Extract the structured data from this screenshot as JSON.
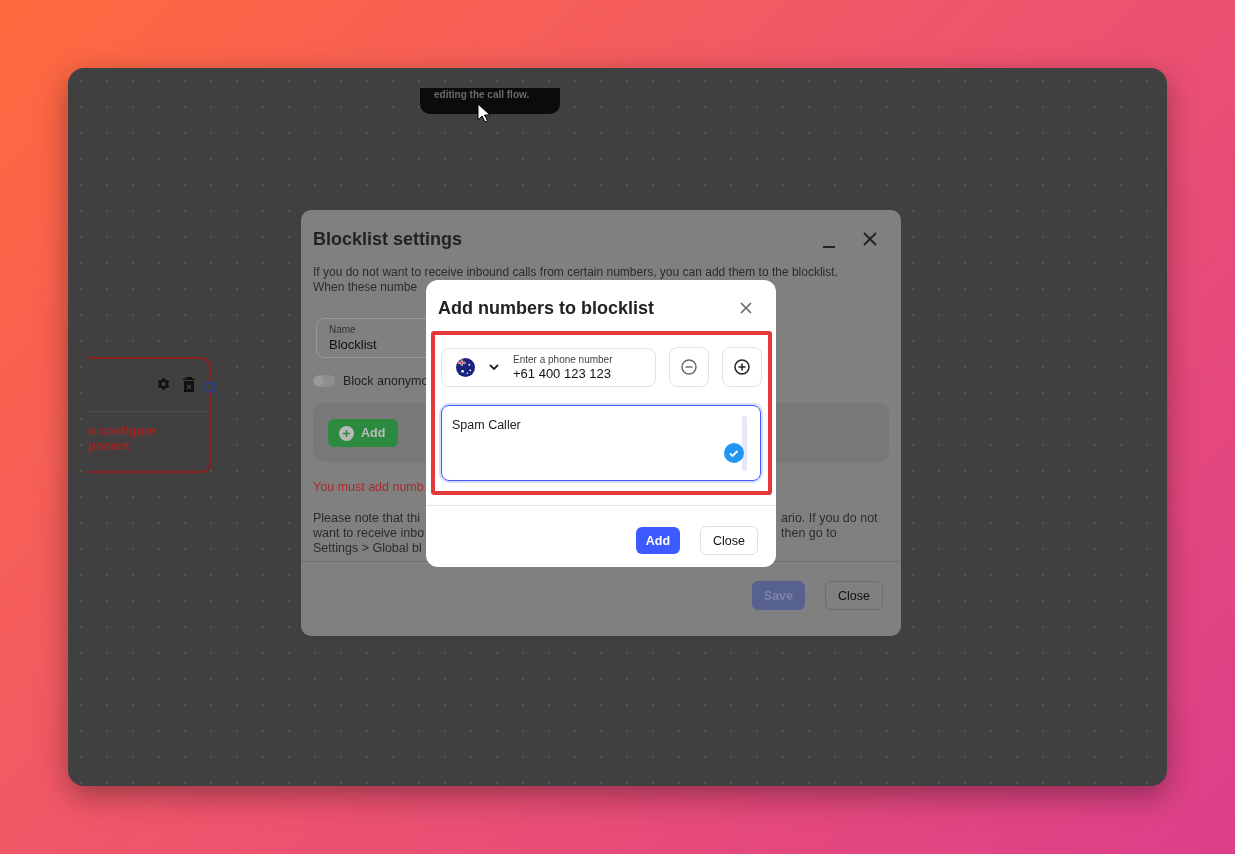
{
  "tooltip": {
    "text": "editing the call flow."
  },
  "node": {
    "message_lines": [
      "o configure",
      "ponent"
    ]
  },
  "settings_dialog": {
    "title": "Blocklist settings",
    "description_lines": [
      "If you do not want to receive inbound calls from certain numbers, you can add them to the blocklist.",
      "When these numbe"
    ],
    "name_field": {
      "label": "Name",
      "value": "Blocklist"
    },
    "anonymous_toggle": {
      "label": "Block anonymo",
      "on": false
    },
    "add_button": "Add",
    "error": "You must add numb",
    "note_lines_left": [
      "Please note that thi",
      "want to receive inbo",
      "Settings > Global bl"
    ],
    "note_lines_right": [
      "ario. If you do not",
      "then go to"
    ],
    "save_button": {
      "label": "Save",
      "disabled": true
    },
    "close_button": "Close"
  },
  "add_dialog": {
    "title": "Add numbers to blocklist",
    "phone_field": {
      "label": "Enter a phone number",
      "value": "+61 400 123 123"
    },
    "note_field": {
      "value": "Spam Caller",
      "valid": true
    },
    "add_button": "Add",
    "close_button": "Close"
  }
}
